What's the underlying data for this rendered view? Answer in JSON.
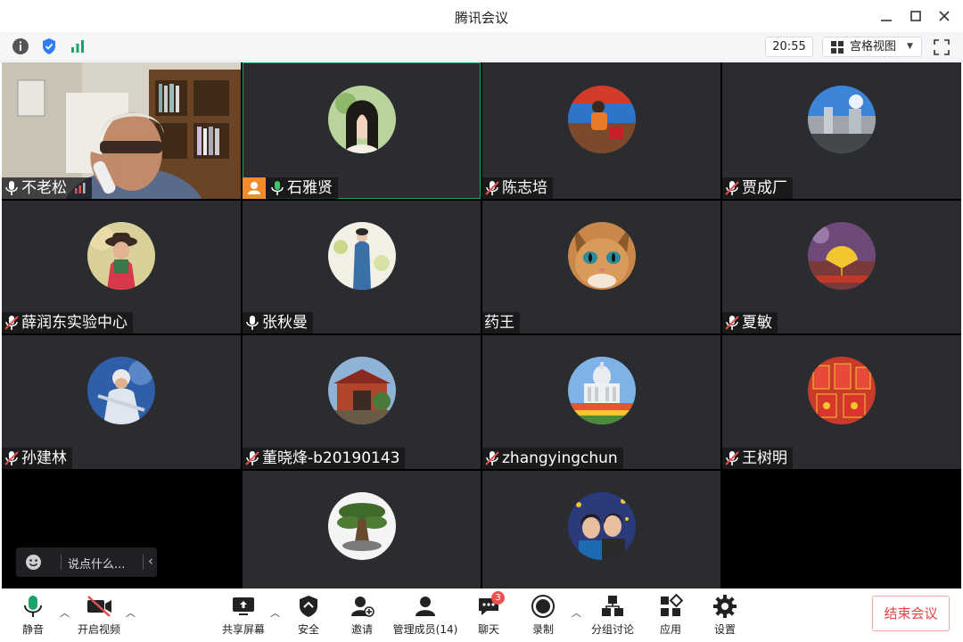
{
  "window": {
    "title": "腾讯会议"
  },
  "infobar": {
    "time": "20:55",
    "view_mode": "宫格视图"
  },
  "participants": [
    {
      "name": "不老松",
      "mic": "on-speaking",
      "media": "camera"
    },
    {
      "name": "石雅贤",
      "mic": "on",
      "media": "avatar",
      "host_badge": true,
      "active": true
    },
    {
      "name": "陈志培",
      "mic": "muted",
      "media": "avatar"
    },
    {
      "name": "贾成厂",
      "mic": "muted",
      "media": "avatar"
    },
    {
      "name": "薛润东实验中心",
      "mic": "muted",
      "media": "avatar"
    },
    {
      "name": "张秋曼",
      "mic": "on",
      "media": "avatar"
    },
    {
      "name": "药王",
      "mic": "none",
      "media": "avatar"
    },
    {
      "name": "夏敏",
      "mic": "muted",
      "media": "avatar"
    },
    {
      "name": "孙建林",
      "mic": "muted",
      "media": "avatar"
    },
    {
      "name": "董晓烽-b20190143",
      "mic": "muted",
      "media": "avatar"
    },
    {
      "name": "zhangyingchun",
      "mic": "muted",
      "media": "avatar"
    },
    {
      "name": "王树明",
      "mic": "muted",
      "media": "avatar"
    }
  ],
  "chat": {
    "placeholder": "说点什么..."
  },
  "toolbar": {
    "mute": "静音",
    "video": "开启视频",
    "share": "共享屏幕",
    "security": "安全",
    "invite": "邀请",
    "members": "管理成员(14)",
    "chat": "聊天",
    "chat_badge": "3",
    "record": "录制",
    "breakout": "分组讨论",
    "apps": "应用",
    "settings": "设置",
    "end": "结束会议"
  },
  "colors": {
    "accent_green": "#1aa366",
    "tile_bg": "#2b2c30",
    "danger_red": "#e64545"
  }
}
